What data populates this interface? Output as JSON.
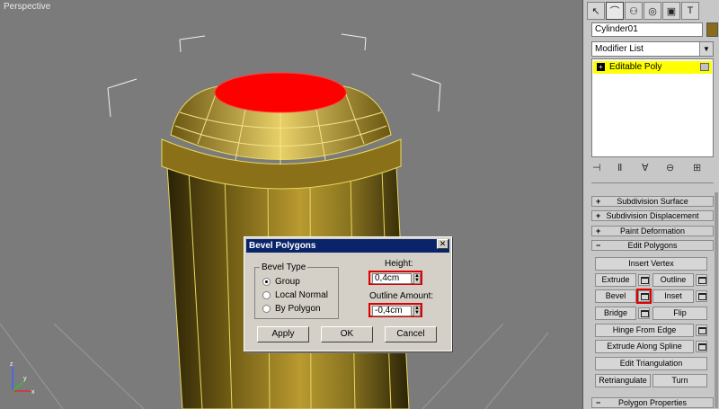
{
  "viewport": {
    "label": "Perspective"
  },
  "panel": {
    "tabs": [
      {
        "icon": "arrow-cursor-icon",
        "glyph": "↖"
      },
      {
        "icon": "modify-curve-icon",
        "glyph": "⌒"
      },
      {
        "icon": "hierarchy-icon",
        "glyph": "⚇"
      },
      {
        "icon": "motion-icon",
        "glyph": "◎"
      },
      {
        "icon": "display-icon",
        "glyph": "▣"
      },
      {
        "icon": "utilities-hammer-icon",
        "glyph": "T"
      }
    ],
    "object_name": "Cylinder01",
    "object_color": "#8a6b1a",
    "modifier_list": "Modifier List",
    "stack_item": "Editable Poly",
    "rollouts": {
      "subdivision_surface": "Subdivision Surface",
      "subdivision_displacement": "Subdivision Displacement",
      "paint_deformation": "Paint Deformation",
      "edit_polygons": "Edit Polygons",
      "polygon_properties": "Polygon Properties"
    },
    "buttons": {
      "insert_vertex": "Insert Vertex",
      "extrude": "Extrude",
      "outline": "Outline",
      "bevel": "Bevel",
      "inset": "Inset",
      "bridge": "Bridge",
      "flip": "Flip",
      "hinge_from_edge": "Hinge From Edge",
      "extrude_along_spline": "Extrude Along Spline",
      "edit_triangulation": "Edit Triangulation",
      "retriangulate": "Retriangulate",
      "turn": "Turn"
    }
  },
  "dialog": {
    "title": "Bevel Polygons",
    "bevel_type_label": "Bevel Type",
    "options": [
      "Group",
      "Local Normal",
      "By Polygon"
    ],
    "selected_option": "Group",
    "height_label": "Height:",
    "height_value": "0,4cm",
    "outline_label": "Outline Amount:",
    "outline_value": "-0,4cm",
    "apply": "Apply",
    "ok": "OK",
    "cancel": "Cancel",
    "close_glyph": "✕"
  },
  "colors": {
    "selection": "#ff0000",
    "mesh": "#c8a83a",
    "highlight": "#ffff00"
  }
}
